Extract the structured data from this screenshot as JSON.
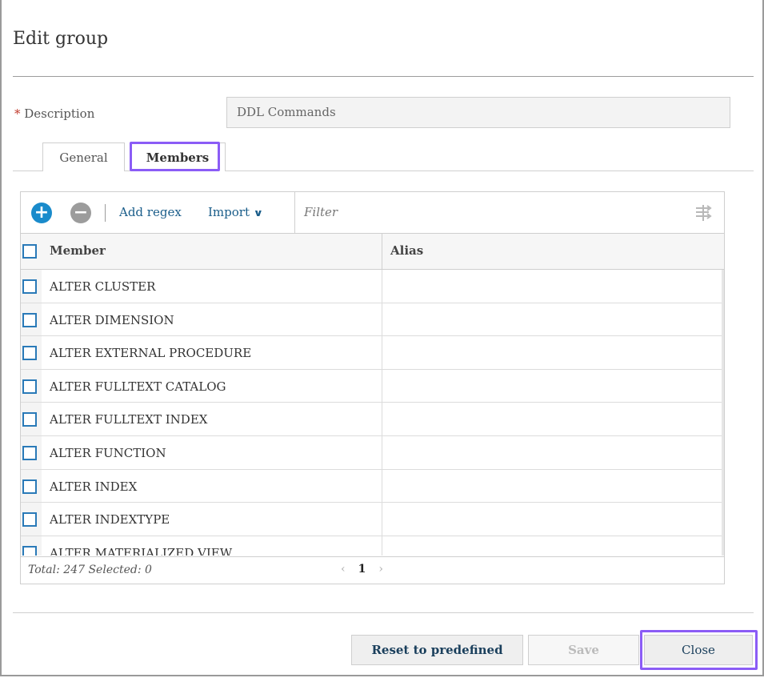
{
  "dialog": {
    "title": "Edit group"
  },
  "description": {
    "required_mark": "*",
    "label": "Description",
    "value": "DDL Commands"
  },
  "tabs": [
    {
      "label": "General"
    },
    {
      "label": "Members"
    }
  ],
  "toolbar": {
    "add_icon": "plus-circle-icon",
    "remove_icon": "minus-circle-icon",
    "add_regex": "Add regex",
    "import": "Import",
    "filter_placeholder": "Filter",
    "filter_icon": "filter-columns-icon"
  },
  "table": {
    "columns": [
      "Member",
      "Alias"
    ],
    "rows": [
      {
        "member": "ALTER CLUSTER",
        "alias": ""
      },
      {
        "member": "ALTER DIMENSION",
        "alias": ""
      },
      {
        "member": "ALTER EXTERNAL PROCEDURE",
        "alias": ""
      },
      {
        "member": "ALTER FULLTEXT CATALOG",
        "alias": ""
      },
      {
        "member": "ALTER FULLTEXT INDEX",
        "alias": ""
      },
      {
        "member": "ALTER FUNCTION",
        "alias": ""
      },
      {
        "member": "ALTER INDEX",
        "alias": ""
      },
      {
        "member": "ALTER INDEXTYPE",
        "alias": ""
      },
      {
        "member": "ALTER MATERIALIZED VIEW",
        "alias": ""
      }
    ],
    "footer": {
      "total_text": "Total: 247 Selected: 0",
      "page": "1"
    }
  },
  "buttons": {
    "reset": "Reset to predefined",
    "save": "Save",
    "close": "Close"
  },
  "colors": {
    "accent": "#1f6f9b",
    "highlight": "#8b5cf6",
    "link": "#1a5d8a"
  }
}
